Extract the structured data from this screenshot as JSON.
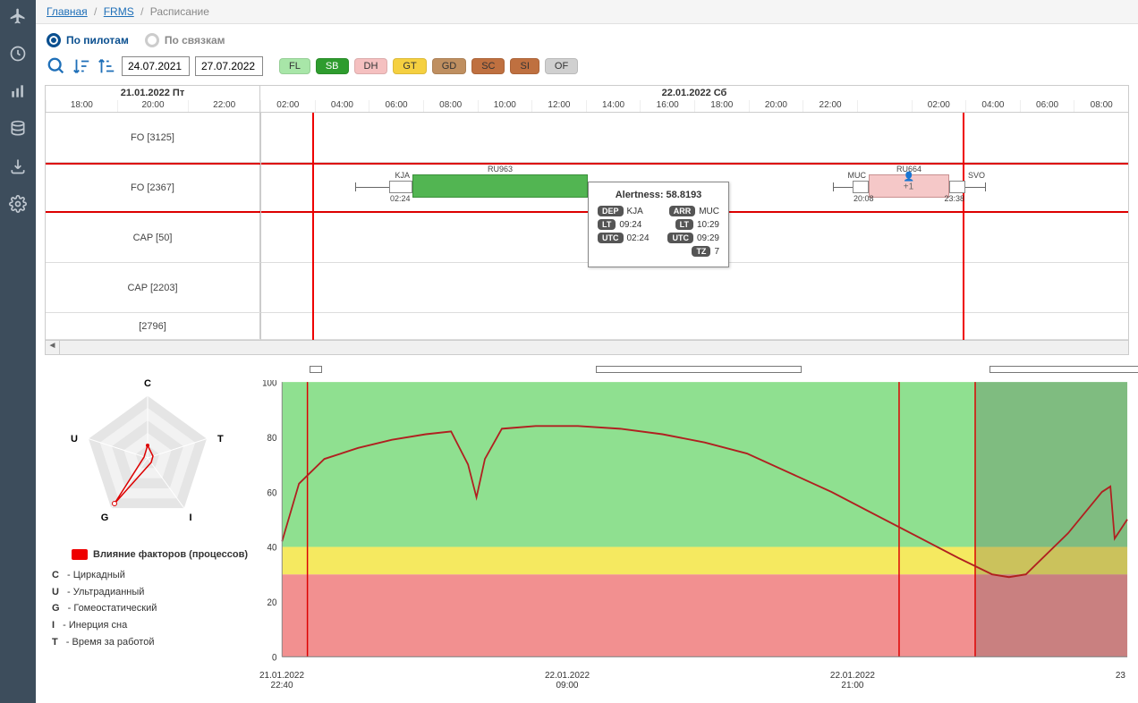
{
  "breadcrumb": {
    "home": "Главная",
    "frms": "FRMS",
    "current": "Расписание"
  },
  "radio": {
    "pilots": "По пилотам",
    "links": "По связкам"
  },
  "dates": {
    "from": "24.07.2021",
    "to": "27.07.2022"
  },
  "badges": {
    "FL": "FL",
    "SB": "SB",
    "DH": "DH",
    "GT": "GT",
    "GD": "GD",
    "SC": "SC",
    "SI": "SI",
    "OF": "OF"
  },
  "gantt": {
    "day1": "21.01.2022 Пт",
    "day2": "22.01.2022 Сб",
    "hours_left": [
      "18:00",
      "20:00",
      "22:00"
    ],
    "hours_right": [
      "02:00",
      "04:00",
      "06:00",
      "08:00",
      "10:00",
      "12:00",
      "14:00",
      "16:00",
      "18:00",
      "20:00",
      "22:00",
      "",
      "02:00",
      "04:00",
      "06:00",
      "08:00"
    ],
    "rows": [
      "FO [3125]",
      "FO [2367]",
      "CAP [50]",
      "CAP [2203]",
      "[2796]"
    ]
  },
  "flights": {
    "f1": {
      "code": "RU963",
      "dep": "KJA",
      "dep_time": "02:24"
    },
    "f2": {
      "code": "RU664",
      "dep": "MUC",
      "arr": "SVO",
      "dep_time": "20:08",
      "arr_time": "23:38",
      "badge": "+1"
    }
  },
  "tooltip": {
    "title": "Alertness: 58.8193",
    "dep_lbl": "DEP",
    "dep": "KJA",
    "arr_lbl": "ARR",
    "arr": "MUC",
    "lt_lbl": "LT",
    "lt_dep": "09:24",
    "lt_arr": "10:29",
    "utc_lbl": "UTC",
    "utc_dep": "02:24",
    "utc_arr": "09:29",
    "tz_lbl": "TZ",
    "tz": "7"
  },
  "radar": {
    "axes": {
      "C": "C",
      "U": "U",
      "G": "G",
      "I": "I",
      "T": "T"
    },
    "legend_title": "Влияние факторов (процессов)",
    "items": {
      "C": "Циркадный",
      "U": "Ультрадианный",
      "G": "Гомеостатический",
      "I": "Инерция сна",
      "T": "Время за работой"
    }
  },
  "chart_data": {
    "type": "line",
    "ylim": [
      0,
      100
    ],
    "yticks": [
      0,
      20,
      40,
      60,
      80,
      100
    ],
    "zones": [
      {
        "from": 0,
        "to": 30,
        "color": "#f29090"
      },
      {
        "from": 30,
        "to": 40,
        "color": "#f5e960"
      },
      {
        "from": 40,
        "to": 100,
        "color": "#8fe090"
      }
    ],
    "xlabels": [
      {
        "d": "21.01.2022",
        "t": "22:40"
      },
      {
        "d": "22.01.2022",
        "t": "09:00"
      },
      {
        "d": "22.01.2022",
        "t": "21:00"
      },
      {
        "d": "23",
        "t": ""
      }
    ],
    "series": [
      {
        "name": "alertness",
        "values": [
          [
            0,
            42
          ],
          [
            2,
            63
          ],
          [
            5,
            72
          ],
          [
            9,
            76
          ],
          [
            13,
            79
          ],
          [
            17,
            81
          ],
          [
            20,
            82
          ],
          [
            22,
            70
          ],
          [
            23,
            58
          ],
          [
            24,
            72
          ],
          [
            26,
            83
          ],
          [
            30,
            84
          ],
          [
            35,
            84
          ],
          [
            40,
            83
          ],
          [
            45,
            81
          ],
          [
            50,
            78
          ],
          [
            55,
            74
          ],
          [
            60,
            67
          ],
          [
            65,
            60
          ],
          [
            70,
            52
          ],
          [
            75,
            44
          ],
          [
            80,
            36
          ],
          [
            84,
            30
          ],
          [
            86,
            29
          ],
          [
            88,
            30
          ],
          [
            93,
            45
          ],
          [
            97,
            60
          ],
          [
            98,
            62
          ],
          [
            98.5,
            43
          ],
          [
            100,
            50
          ]
        ]
      }
    ],
    "vlines": [
      3,
      73,
      82
    ],
    "shade": {
      "from": 82,
      "to": 100
    }
  }
}
